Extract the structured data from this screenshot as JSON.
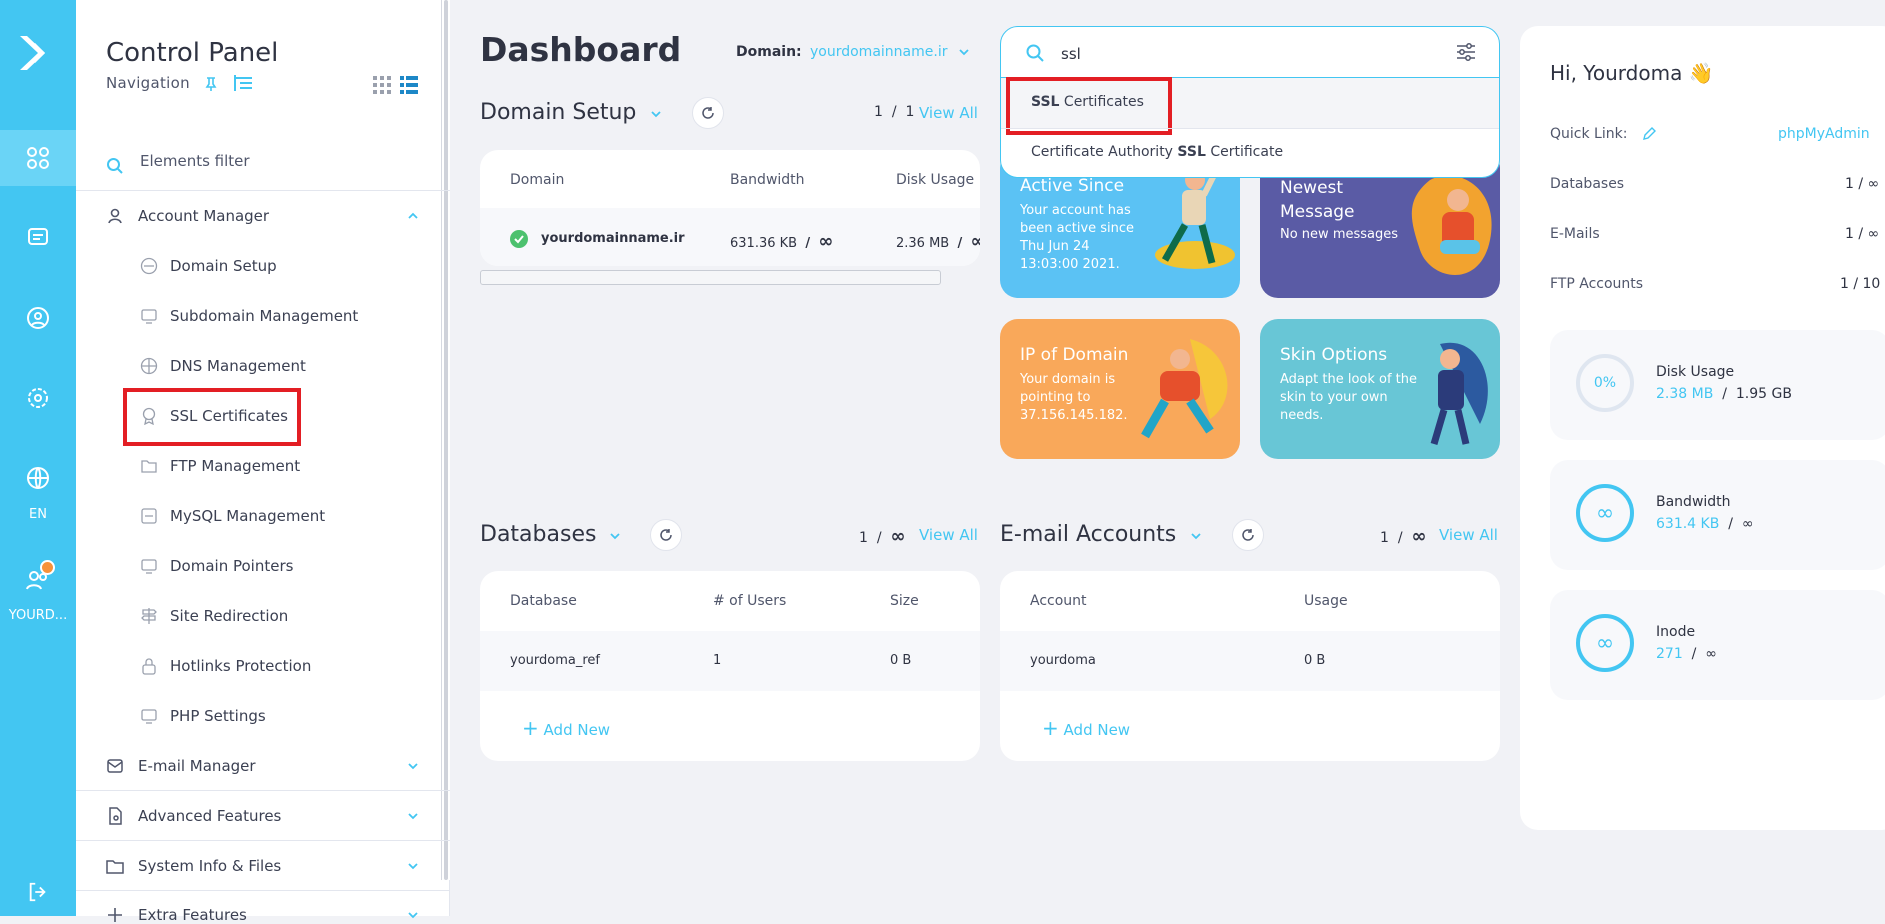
{
  "rail": {
    "lang": "EN",
    "user": "YOURD..."
  },
  "sidebar": {
    "title": "Control Panel",
    "nav_label": "Navigation",
    "filter": "Elements filter",
    "account_manager": "Account Manager",
    "items": [
      "Domain Setup",
      "Subdomain Management",
      "DNS Management",
      "SSL Certificates",
      "FTP Management",
      "MySQL Management",
      "Domain Pointers",
      "Site Redirection",
      "Hotlinks Protection",
      "PHP Settings"
    ],
    "groups": [
      "E-mail Manager",
      "Advanced Features",
      "System Info & Files",
      "Extra Features"
    ]
  },
  "header": {
    "title": "Dashboard",
    "domain_label": "Domain:",
    "domain_value": "yourdomainname.ir"
  },
  "search": {
    "query": "ssl",
    "opt1_b": "SSL",
    "opt1_rest": " Certificates",
    "opt2_a": "Certificate Authority ",
    "opt2_b": "SSL",
    "opt2_c": " Certificate"
  },
  "domain_setup": {
    "title": "Domain Setup",
    "page": "1",
    "sep": "/",
    "total": "1",
    "view_all": "View All",
    "cols": [
      "Domain",
      "Bandwidth",
      "Disk Usage"
    ],
    "row": {
      "domain": "yourdomainname.ir",
      "bandwidth": "631.36 KB",
      "bw_sep": "/",
      "bw_max": "∞",
      "disk": "2.36 MB",
      "disk_sep": "/",
      "disk_max": "∞"
    }
  },
  "tiles": {
    "active": {
      "title": "Active Since",
      "desc": "Your account has been active since Thu Jun 24 13:03:00 2021."
    },
    "message": {
      "title": "Newest Message",
      "desc": "No new messages"
    },
    "ip": {
      "title": "IP of Domain",
      "desc": "Your domain is pointing to 37.156.145.182."
    },
    "skin": {
      "title": "Skin Options",
      "desc": "Adapt the look of the skin to your own needs."
    }
  },
  "databases": {
    "title": "Databases",
    "page": "1",
    "sep": "/",
    "total": "∞",
    "view_all": "View All",
    "cols": [
      "Database",
      "# of Users",
      "Size"
    ],
    "row": {
      "name": "yourdoma_ref",
      "users": "1",
      "size": "0 B"
    },
    "add": "Add New"
  },
  "emails": {
    "title": "E-mail Accounts",
    "page": "1",
    "sep": "/",
    "total": "∞",
    "view_all": "View All",
    "cols": [
      "Account",
      "Usage"
    ],
    "row": {
      "name": "yourdoma",
      "usage": "0 B"
    },
    "add": "Add New"
  },
  "right": {
    "greeting": "Hi, Yourdoma 👋",
    "quick_link_label": "Quick Link:",
    "quick_link": "phpMyAdmin",
    "stats": [
      {
        "label": "Databases",
        "value": "1 / ∞"
      },
      {
        "label": "E-Mails",
        "value": "1 / ∞"
      },
      {
        "label": "FTP Accounts",
        "value": "1 / 10"
      }
    ],
    "disk": {
      "ring": "0%",
      "label": "Disk Usage",
      "used": "2.38 MB",
      "sep": "/",
      "max": "1.95 GB"
    },
    "bandwidth": {
      "ring": "∞",
      "label": "Bandwidth",
      "used": "631.4 KB",
      "sep": "/",
      "max": "∞"
    },
    "inode": {
      "ring": "∞",
      "label": "Inode",
      "used": "271",
      "sep": "/",
      "max": "∞"
    }
  },
  "colors": {
    "accent": "#43c6f2",
    "highlight": "#e31e24",
    "tile_blue": "#5bc2f4",
    "tile_purple": "#5a5ba5",
    "tile_orange": "#f9a85a",
    "tile_teal": "#68c6d6"
  }
}
